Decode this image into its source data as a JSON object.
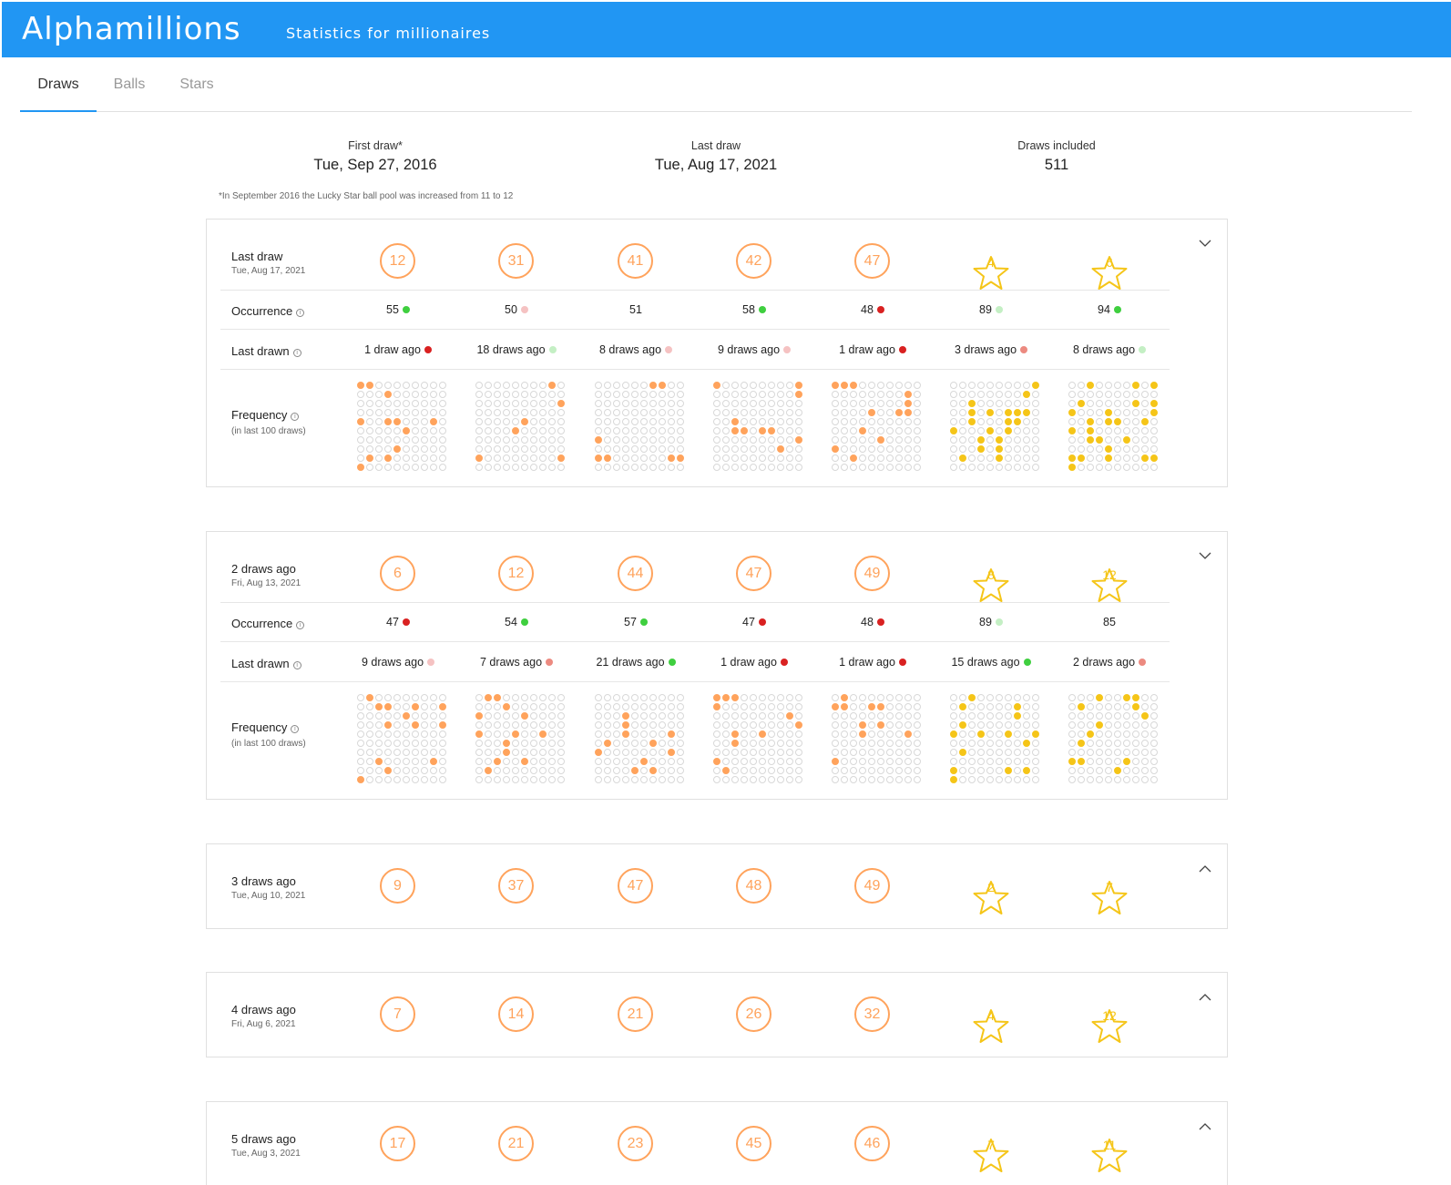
{
  "app": {
    "title": "Alphamillions",
    "tagline": "Statistics for millionaires"
  },
  "tabs": [
    "Draws",
    "Balls",
    "Stars"
  ],
  "summary": {
    "first_label": "First draw*",
    "first_value": "Tue, Sep 27, 2016",
    "last_label": "Last draw",
    "last_value": "Tue, Aug 17, 2021",
    "count_label": "Draws included",
    "count_value": "511",
    "footnote": "*In September 2016 the Lucky Star ball pool was increased from 11 to 12"
  },
  "labels": {
    "occurrence": "Occurrence",
    "last_drawn": "Last drawn",
    "frequency": "Frequency",
    "frequency_sub": "(in last 100 draws)",
    "info": "i"
  },
  "colors": {
    "ball": "#ffa35c",
    "star": "#f5c518",
    "dot_green": "#3fcf3f",
    "dot_lightgreen": "#c4efc4",
    "dot_red": "#d92121",
    "dot_pink": "#f5c2c2",
    "dot_salmon": "#ec8a80"
  },
  "icons": {
    "collapse": "chevron-down-icon",
    "expand": "chevron-up-icon"
  },
  "draws": [
    {
      "title": "Last draw",
      "date": "Tue, Aug 17, 2021",
      "expanded": true,
      "balls": [
        "12",
        "31",
        "41",
        "42",
        "47"
      ],
      "stars": [
        "4",
        "6"
      ],
      "occurrence": [
        {
          "v": "55",
          "dot": "green"
        },
        {
          "v": "50",
          "dot": "pink"
        },
        {
          "v": "51",
          "dot": ""
        },
        {
          "v": "58",
          "dot": "green"
        },
        {
          "v": "48",
          "dot": "red"
        },
        {
          "v": "89",
          "dot": "lightgreen"
        },
        {
          "v": "94",
          "dot": "green"
        }
      ],
      "last_drawn": [
        {
          "v": "1 draw ago",
          "dot": "red"
        },
        {
          "v": "18 draws ago",
          "dot": "lightgreen"
        },
        {
          "v": "8 draws ago",
          "dot": "pink"
        },
        {
          "v": "9 draws ago",
          "dot": "pink"
        },
        {
          "v": "1 draw ago",
          "dot": "red"
        },
        {
          "v": "3 draws ago",
          "dot": "salmon"
        },
        {
          "v": "8 draws ago",
          "dot": "lightgreen"
        }
      ],
      "frequency": [
        [
          0,
          1,
          13,
          40,
          43,
          44,
          48,
          55,
          74,
          81,
          83,
          90
        ],
        [
          8,
          29,
          45,
          54,
          80,
          89
        ],
        [
          6,
          7,
          60,
          80,
          81,
          88,
          89
        ],
        [
          0,
          9,
          19,
          42,
          52,
          53,
          55,
          56,
          69,
          77
        ],
        [
          0,
          1,
          2,
          18,
          28,
          34,
          37,
          38,
          53,
          65,
          70,
          82
        ],
        [
          9,
          18,
          22,
          32,
          34,
          36,
          37,
          38,
          42,
          46,
          47,
          50,
          54,
          56,
          63,
          65,
          73,
          75,
          81,
          85
        ],
        [
          2,
          7,
          9,
          21,
          27,
          29,
          30,
          34,
          39,
          42,
          44,
          45,
          48,
          50,
          52,
          62,
          63,
          66,
          74,
          80,
          81,
          84,
          88,
          89,
          90
        ]
      ]
    },
    {
      "title": "2 draws ago",
      "date": "Fri, Aug 13, 2021",
      "expanded": true,
      "balls": [
        "6",
        "12",
        "44",
        "47",
        "49"
      ],
      "stars": [
        "8",
        "12"
      ],
      "occurrence": [
        {
          "v": "47",
          "dot": "red"
        },
        {
          "v": "54",
          "dot": "green"
        },
        {
          "v": "57",
          "dot": "green"
        },
        {
          "v": "47",
          "dot": "red"
        },
        {
          "v": "48",
          "dot": "red"
        },
        {
          "v": "89",
          "dot": "lightgreen"
        },
        {
          "v": "85",
          "dot": ""
        }
      ],
      "last_drawn": [
        {
          "v": "9 draws ago",
          "dot": "pink"
        },
        {
          "v": "7 draws ago",
          "dot": "salmon"
        },
        {
          "v": "21 draws ago",
          "dot": "green"
        },
        {
          "v": "1 draw ago",
          "dot": "red"
        },
        {
          "v": "1 draw ago",
          "dot": "red"
        },
        {
          "v": "15 draws ago",
          "dot": "green"
        },
        {
          "v": "2 draws ago",
          "dot": "salmon"
        }
      ],
      "frequency": [
        [
          1,
          12,
          13,
          16,
          19,
          25,
          33,
          36,
          39,
          72,
          78,
          83,
          90
        ],
        [
          1,
          2,
          13,
          20,
          25,
          40,
          44,
          47,
          53,
          63,
          72,
          75,
          81
        ],
        [
          23,
          33,
          43,
          48,
          51,
          56,
          60,
          68,
          75,
          84,
          86
        ],
        [
          0,
          1,
          2,
          10,
          28,
          39,
          42,
          45,
          52,
          70,
          81
        ],
        [
          1,
          10,
          11,
          14,
          15,
          33,
          35,
          43,
          48,
          70
        ],
        [
          2,
          11,
          17,
          27,
          31,
          40,
          43,
          46,
          49,
          58,
          61,
          80,
          86,
          88,
          90
        ],
        [
          3,
          6,
          7,
          11,
          17,
          28,
          33,
          42,
          51,
          70,
          71,
          76,
          85
        ]
      ]
    },
    {
      "title": "3 draws ago",
      "date": "Tue, Aug 10, 2021",
      "expanded": false,
      "balls": [
        "9",
        "37",
        "47",
        "48",
        "49"
      ],
      "stars": [
        "2",
        "7"
      ]
    },
    {
      "title": "4 draws ago",
      "date": "Fri, Aug 6, 2021",
      "expanded": false,
      "balls": [
        "7",
        "14",
        "21",
        "26",
        "32"
      ],
      "stars": [
        "4",
        "12"
      ]
    },
    {
      "title": "5 draws ago",
      "date": "Tue, Aug 3, 2021",
      "expanded": false,
      "balls": [
        "17",
        "21",
        "23",
        "45",
        "46"
      ],
      "stars": [
        "7",
        "11"
      ]
    }
  ]
}
